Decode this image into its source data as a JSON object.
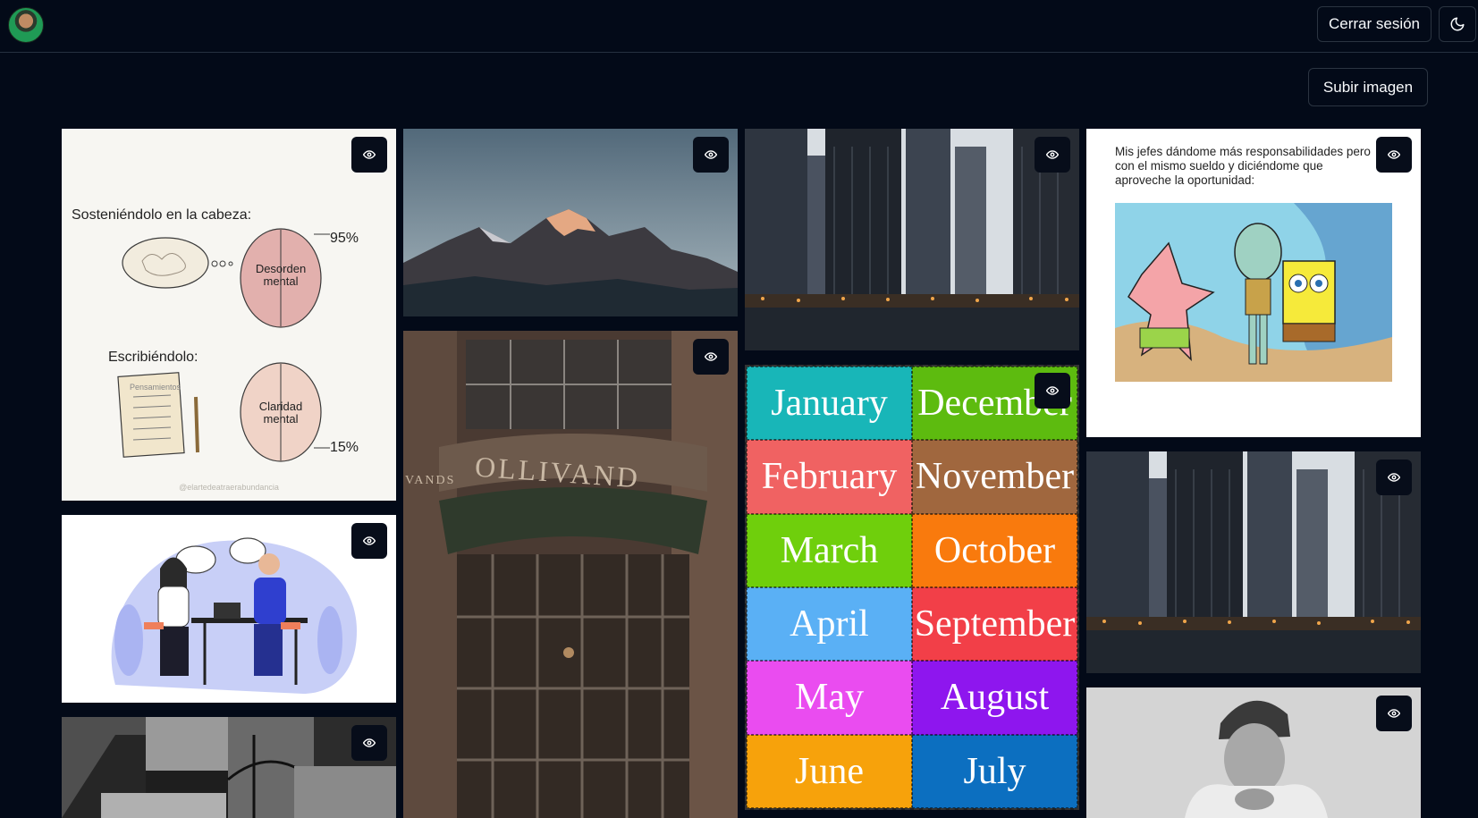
{
  "header": {
    "logout_label": "Cerrar sesión",
    "theme_icon": "moon-icon",
    "avatar_icon": "user-avatar"
  },
  "toolbar": {
    "upload_label": "Subir imagen"
  },
  "gallery": {
    "view_icon": "eye-icon",
    "cards": {
      "note": {
        "title_top": "Sosteniéndolo en la cabeza:",
        "label_top": "Desorden mental",
        "pct_top": "95%",
        "title_bottom": "Escribiéndolo:",
        "paper_label": "Pensamientos",
        "label_bottom": "Claridad mental",
        "pct_bottom": "15%",
        "credit": "@elartedeatraerabundancia"
      },
      "meme": {
        "text": "Mis jefes dándome más responsabilidades pero con el mismo sueldo y diciéndome que aproveche la oportunidad:"
      },
      "shop": {
        "sign": "OLLIVAND",
        "side_sign": "VANDS"
      },
      "months": [
        {
          "name": "January",
          "color": "#18b6b8"
        },
        {
          "name": "December",
          "color": "#5dbb0f"
        },
        {
          "name": "February",
          "color": "#f06262"
        },
        {
          "name": "November",
          "color": "#a0673e"
        },
        {
          "name": "March",
          "color": "#6fcf0c"
        },
        {
          "name": "October",
          "color": "#f97a0d"
        },
        {
          "name": "April",
          "color": "#5ab0f5"
        },
        {
          "name": "September",
          "color": "#f23f48"
        },
        {
          "name": "May",
          "color": "#ea4cf0"
        },
        {
          "name": "August",
          "color": "#8e16ee"
        },
        {
          "name": "June",
          "color": "#f7a20b"
        },
        {
          "name": "July",
          "color": "#0c6fc0"
        }
      ]
    }
  },
  "colors": {
    "background": "#030a18",
    "border": "#2b3441",
    "button_bg": "#070d1a"
  }
}
